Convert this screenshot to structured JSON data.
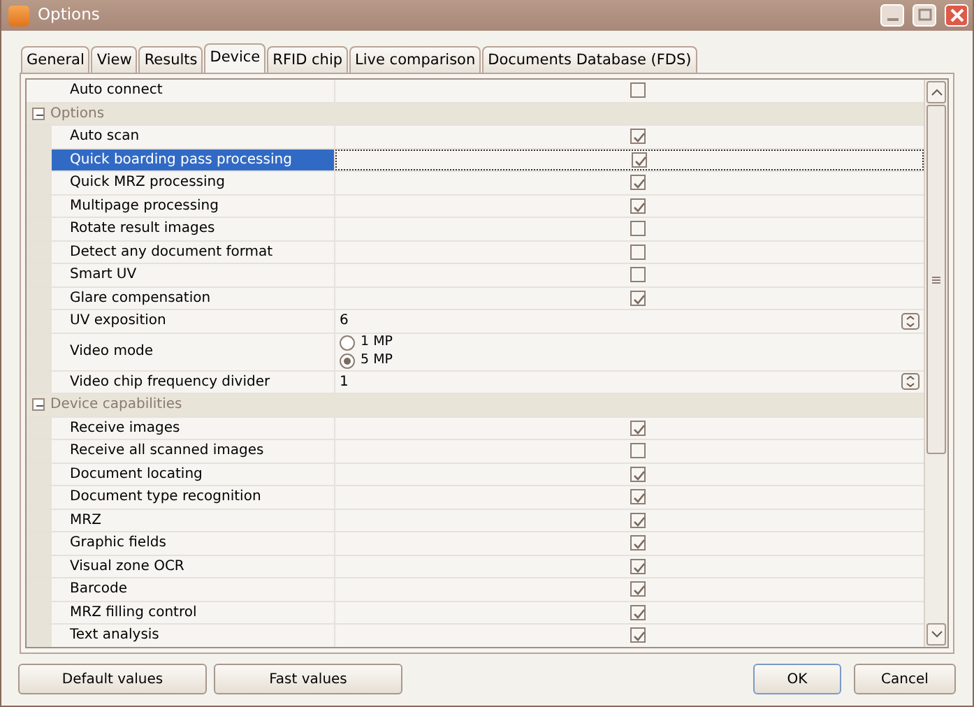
{
  "window": {
    "title": "Options"
  },
  "tabs": [
    {
      "label": "General",
      "selected": false
    },
    {
      "label": "View",
      "selected": false
    },
    {
      "label": "Results",
      "selected": false
    },
    {
      "label": "Device",
      "selected": true
    },
    {
      "label": "RFID chip",
      "selected": false
    },
    {
      "label": "Live comparison",
      "selected": false
    },
    {
      "label": "Documents Database (FDS)",
      "selected": false
    }
  ],
  "grid": {
    "rows": [
      {
        "kind": "checkbox",
        "label": "Auto connect",
        "checked": false,
        "selected": false
      },
      {
        "kind": "group",
        "label": "Options",
        "expanded": true,
        "children": [
          {
            "kind": "checkbox",
            "label": "Auto scan",
            "checked": true,
            "selected": false
          },
          {
            "kind": "checkbox",
            "label": "Quick boarding pass processing",
            "checked": true,
            "selected": true
          },
          {
            "kind": "checkbox",
            "label": "Quick MRZ processing",
            "checked": true,
            "selected": false
          },
          {
            "kind": "checkbox",
            "label": "Multipage processing",
            "checked": true,
            "selected": false
          },
          {
            "kind": "checkbox",
            "label": "Rotate result images",
            "checked": false,
            "selected": false
          },
          {
            "kind": "checkbox",
            "label": "Detect any document format",
            "checked": false,
            "selected": false
          },
          {
            "kind": "checkbox",
            "label": "Smart UV",
            "checked": false,
            "selected": false
          },
          {
            "kind": "checkbox",
            "label": "Glare compensation",
            "checked": true,
            "selected": false
          },
          {
            "kind": "number",
            "label": "UV exposition",
            "value": "6",
            "selected": false
          },
          {
            "kind": "radio",
            "label": "Video mode",
            "selected": false,
            "options": [
              {
                "label": "1 MP",
                "selected": false
              },
              {
                "label": "5 MP",
                "selected": true
              }
            ]
          },
          {
            "kind": "number",
            "label": "Video chip frequency divider",
            "value": "1",
            "selected": false
          }
        ]
      },
      {
        "kind": "group",
        "label": "Device capabilities",
        "expanded": true,
        "children": [
          {
            "kind": "checkbox",
            "label": "Receive images",
            "checked": true,
            "selected": false
          },
          {
            "kind": "checkbox",
            "label": "Receive all scanned images",
            "checked": false,
            "selected": false
          },
          {
            "kind": "checkbox",
            "label": "Document locating",
            "checked": true,
            "selected": false
          },
          {
            "kind": "checkbox",
            "label": "Document type recognition",
            "checked": true,
            "selected": false
          },
          {
            "kind": "checkbox",
            "label": "MRZ",
            "checked": true,
            "selected": false
          },
          {
            "kind": "checkbox",
            "label": "Graphic fields",
            "checked": true,
            "selected": false
          },
          {
            "kind": "checkbox",
            "label": "Visual zone OCR",
            "checked": true,
            "selected": false
          },
          {
            "kind": "checkbox",
            "label": "Barcode",
            "checked": true,
            "selected": false
          },
          {
            "kind": "checkbox",
            "label": "MRZ filling control",
            "checked": true,
            "selected": false
          },
          {
            "kind": "checkbox",
            "label": "Text analysis",
            "checked": true,
            "selected": false
          }
        ]
      }
    ]
  },
  "buttons": [
    {
      "label": "Default values",
      "kind": "left",
      "default": false
    },
    {
      "label": "Fast values",
      "kind": "left",
      "default": false
    },
    {
      "label": "OK",
      "kind": "right",
      "default": true
    },
    {
      "label": "Cancel",
      "kind": "right",
      "default": false
    }
  ]
}
